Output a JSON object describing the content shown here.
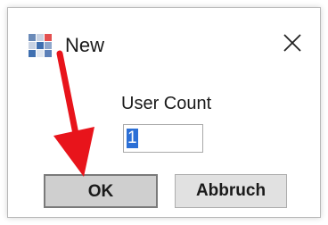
{
  "dialog": {
    "title": "New",
    "close_icon": "close-icon",
    "app_icon": "app-grid-icon"
  },
  "form": {
    "label": "User Count",
    "value": "1"
  },
  "buttons": {
    "ok_label": "OK",
    "cancel_label": "Abbruch"
  },
  "annotation": {
    "arrow_color": "#e8141b"
  },
  "colors": {
    "selection": "#2b6fd6",
    "button_bg": "#e1e1e1",
    "default_button_bg": "#cfcfcf"
  }
}
